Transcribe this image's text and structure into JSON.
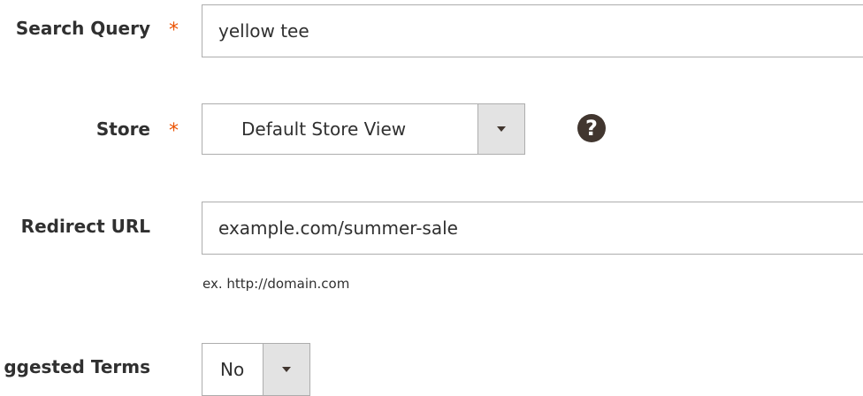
{
  "form": {
    "search_query": {
      "label": "Search Query",
      "required_mark": "*",
      "value": "yellow tee"
    },
    "store": {
      "label": "Store",
      "required_mark": "*",
      "selected": "Default Store View",
      "help_icon": "question-circle-icon",
      "help_glyph": "?"
    },
    "redirect_url": {
      "label": "Redirect URL",
      "value": "example.com/summer-sale",
      "note": "ex. http://domain.com"
    },
    "suggested_terms": {
      "label": "ggested Terms",
      "selected": "No"
    }
  },
  "colors": {
    "required": "#eb5202",
    "text": "#303030",
    "border": "#adadad",
    "select_button": "#e3e3e3",
    "help_icon": "#41362f"
  }
}
